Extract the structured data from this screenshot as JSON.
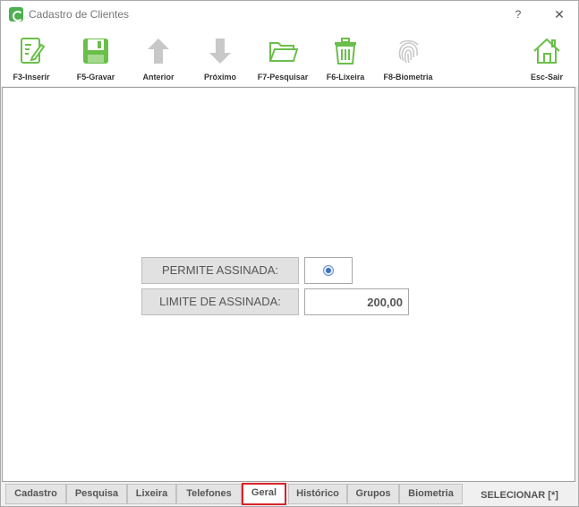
{
  "window": {
    "title": "Cadastro de Clientes",
    "help_glyph": "?",
    "close_glyph": "✕"
  },
  "toolbar": {
    "buttons": [
      {
        "label": "F3-Inserir",
        "icon": "edit-document-icon",
        "enabled": true
      },
      {
        "label": "F5-Gravar",
        "icon": "floppy-disk-icon",
        "enabled": true
      },
      {
        "label": "Anterior",
        "icon": "arrow-up-icon",
        "enabled": false
      },
      {
        "label": "Próximo",
        "icon": "arrow-down-icon",
        "enabled": false
      },
      {
        "label": "F7-Pesquisar",
        "icon": "folder-icon",
        "enabled": true
      },
      {
        "label": "F6-Lixeira",
        "icon": "trash-icon",
        "enabled": true
      },
      {
        "label": "F8-Biometria",
        "icon": "fingerprint-icon",
        "enabled": false
      },
      {
        "label": "Esc-Sair",
        "icon": "home-icon",
        "enabled": true
      }
    ]
  },
  "form": {
    "permite_assinada_label": "PERMITE ASSINADA:",
    "permite_assinada_checked": true,
    "limite_assinada_label": "LIMITE DE ASSINADA:",
    "limite_assinada_value": "200,00"
  },
  "tabs": [
    {
      "label": "Cadastro",
      "active": false
    },
    {
      "label": "Pesquisa",
      "active": false
    },
    {
      "label": "Lixeira",
      "active": false
    },
    {
      "label": "Telefones",
      "active": false
    },
    {
      "label": "Geral",
      "active": true
    },
    {
      "label": "Histórico",
      "active": false
    },
    {
      "label": "Grupos",
      "active": false
    },
    {
      "label": "Biometria",
      "active": false
    }
  ],
  "status": {
    "text": "SELECIONAR [*]"
  },
  "colors": {
    "icon_green": "#6abf4b",
    "icon_disabled": "#c8c8c8",
    "active_tab_border": "#d8232a"
  }
}
